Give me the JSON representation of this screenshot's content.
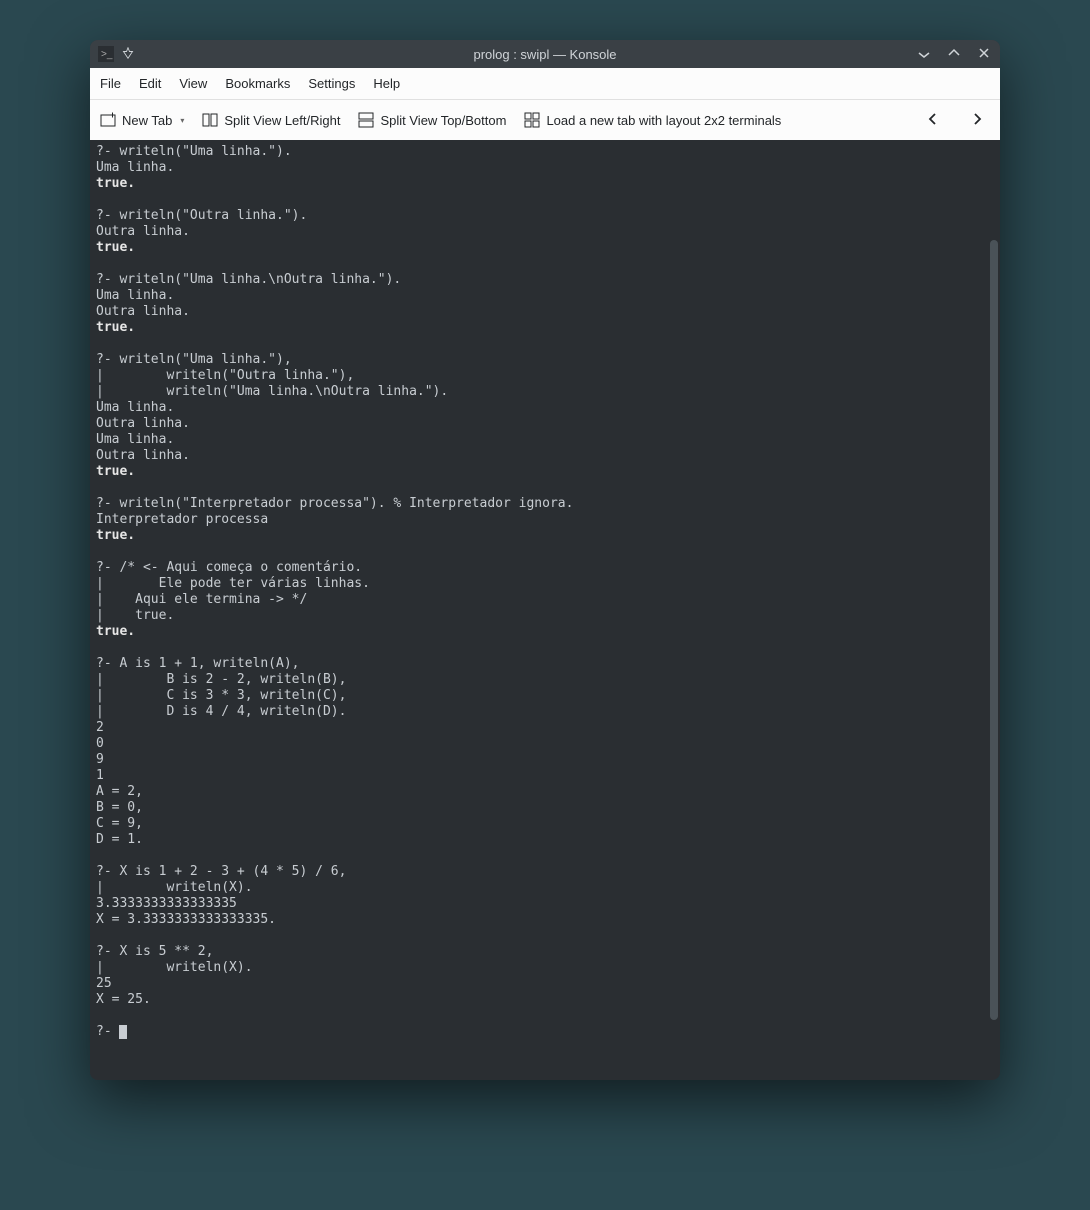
{
  "titlebar": {
    "title": "prolog : swipl — Konsole"
  },
  "menubar": {
    "items": [
      "File",
      "Edit",
      "View",
      "Bookmarks",
      "Settings",
      "Help"
    ]
  },
  "toolbar": {
    "new_tab": "New Tab",
    "split_lr": "Split View Left/Right",
    "split_tb": "Split View Top/Bottom",
    "load_layout": "Load a new tab with layout 2x2 terminals"
  },
  "terminal": {
    "lines": [
      {
        "t": "?- writeln(\"Uma linha.\").",
        "b": false
      },
      {
        "t": "Uma linha.",
        "b": false
      },
      {
        "t": "true.",
        "b": true
      },
      {
        "t": "",
        "b": false
      },
      {
        "t": "?- writeln(\"Outra linha.\").",
        "b": false
      },
      {
        "t": "Outra linha.",
        "b": false
      },
      {
        "t": "true.",
        "b": true
      },
      {
        "t": "",
        "b": false
      },
      {
        "t": "?- writeln(\"Uma linha.\\nOutra linha.\").",
        "b": false
      },
      {
        "t": "Uma linha.",
        "b": false
      },
      {
        "t": "Outra linha.",
        "b": false
      },
      {
        "t": "true.",
        "b": true
      },
      {
        "t": "",
        "b": false
      },
      {
        "t": "?- writeln(\"Uma linha.\"),",
        "b": false
      },
      {
        "t": "|        writeln(\"Outra linha.\"),",
        "b": false
      },
      {
        "t": "|        writeln(\"Uma linha.\\nOutra linha.\").",
        "b": false
      },
      {
        "t": "Uma linha.",
        "b": false
      },
      {
        "t": "Outra linha.",
        "b": false
      },
      {
        "t": "Uma linha.",
        "b": false
      },
      {
        "t": "Outra linha.",
        "b": false
      },
      {
        "t": "true.",
        "b": true
      },
      {
        "t": "",
        "b": false
      },
      {
        "t": "?- writeln(\"Interpretador processa\"). % Interpretador ignora.",
        "b": false
      },
      {
        "t": "Interpretador processa",
        "b": false
      },
      {
        "t": "true.",
        "b": true
      },
      {
        "t": "",
        "b": false
      },
      {
        "t": "?- /* <- Aqui começa o comentário.",
        "b": false
      },
      {
        "t": "|       Ele pode ter várias linhas.",
        "b": false
      },
      {
        "t": "|    Aqui ele termina -> */",
        "b": false
      },
      {
        "t": "|    true.",
        "b": false
      },
      {
        "t": "true.",
        "b": true
      },
      {
        "t": "",
        "b": false
      },
      {
        "t": "?- A is 1 + 1, writeln(A),",
        "b": false
      },
      {
        "t": "|        B is 2 - 2, writeln(B),",
        "b": false
      },
      {
        "t": "|        C is 3 * 3, writeln(C),",
        "b": false
      },
      {
        "t": "|        D is 4 / 4, writeln(D).",
        "b": false
      },
      {
        "t": "2",
        "b": false
      },
      {
        "t": "0",
        "b": false
      },
      {
        "t": "9",
        "b": false
      },
      {
        "t": "1",
        "b": false
      },
      {
        "t": "A = 2,",
        "b": false
      },
      {
        "t": "B = 0,",
        "b": false
      },
      {
        "t": "C = 9,",
        "b": false
      },
      {
        "t": "D = 1.",
        "b": false
      },
      {
        "t": "",
        "b": false
      },
      {
        "t": "?- X is 1 + 2 - 3 + (4 * 5) / 6,",
        "b": false
      },
      {
        "t": "|        writeln(X).",
        "b": false
      },
      {
        "t": "3.3333333333333335",
        "b": false
      },
      {
        "t": "X = 3.3333333333333335.",
        "b": false
      },
      {
        "t": "",
        "b": false
      },
      {
        "t": "?- X is 5 ** 2,",
        "b": false
      },
      {
        "t": "|        writeln(X).",
        "b": false
      },
      {
        "t": "25",
        "b": false
      },
      {
        "t": "X = 25.",
        "b": false
      },
      {
        "t": "",
        "b": false
      }
    ],
    "prompt": "?- "
  }
}
